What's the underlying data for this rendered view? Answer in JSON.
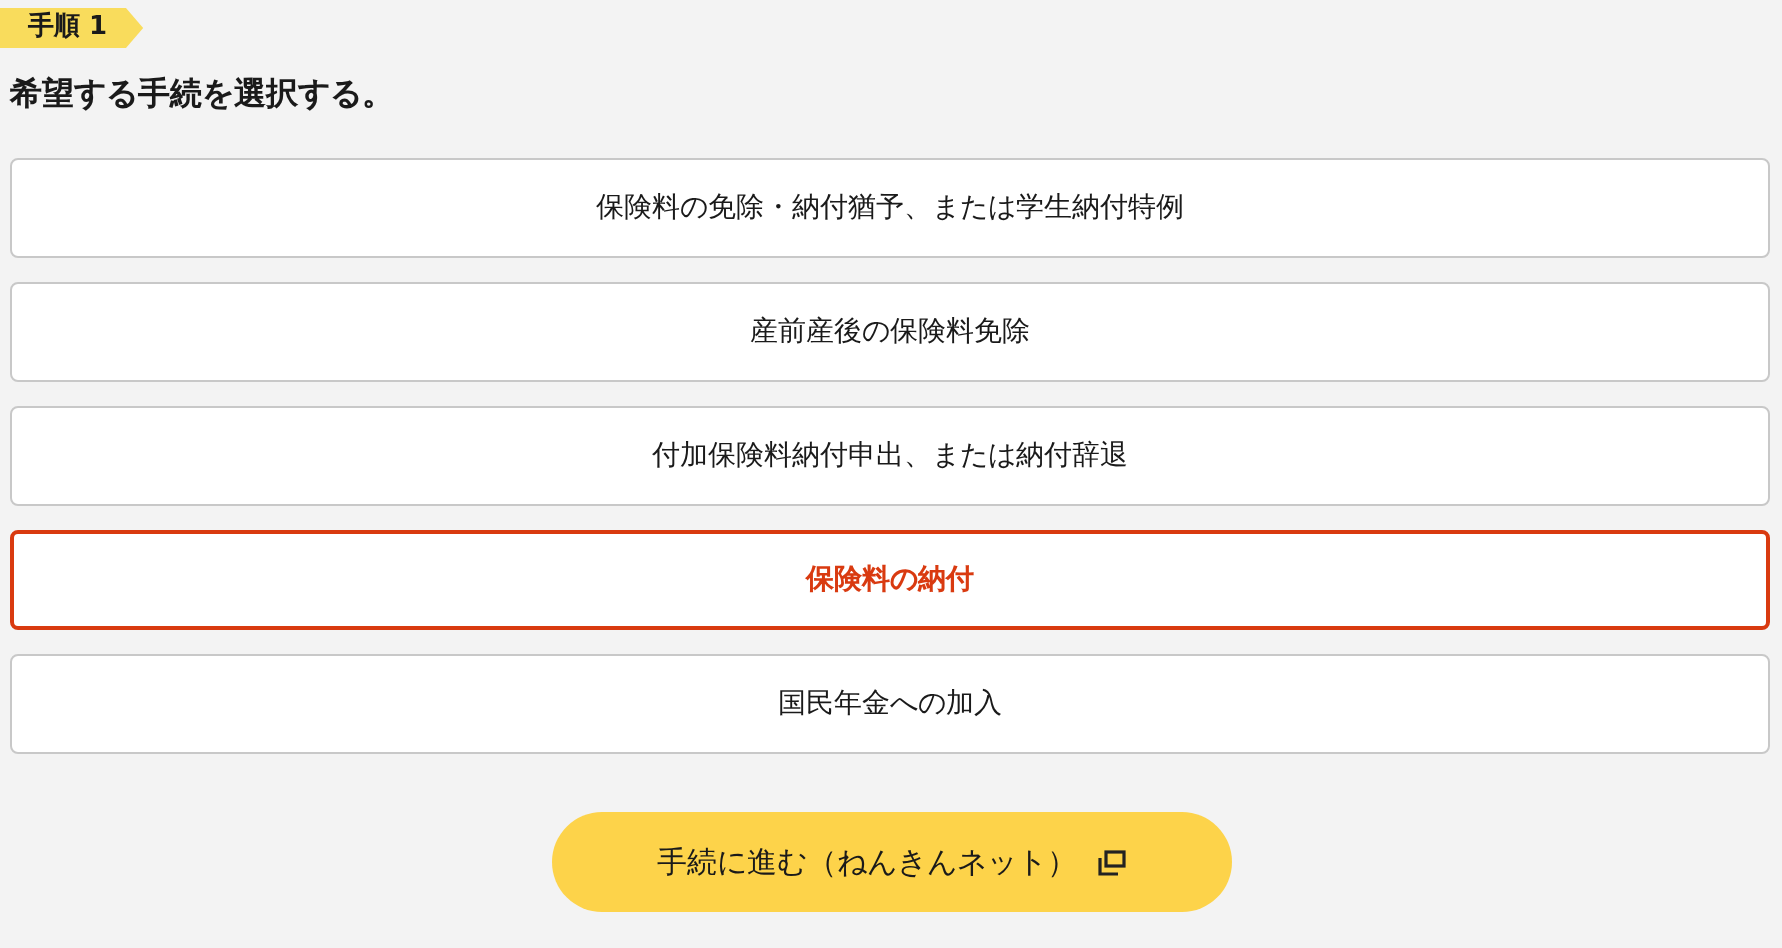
{
  "step_badge": "手順 1",
  "heading": "希望する手続を選択する。",
  "options": [
    {
      "label": "保険料の免除・納付猶予、または学生納付特例",
      "selected": false
    },
    {
      "label": "産前産後の保険料免除",
      "selected": false
    },
    {
      "label": "付加保険料納付申出、または納付辞退",
      "selected": false
    },
    {
      "label": "保険料の納付",
      "selected": true
    },
    {
      "label": "国民年金への加入",
      "selected": false
    }
  ],
  "proceed_button": {
    "label": "手続に進む（ねんきんネット）"
  }
}
